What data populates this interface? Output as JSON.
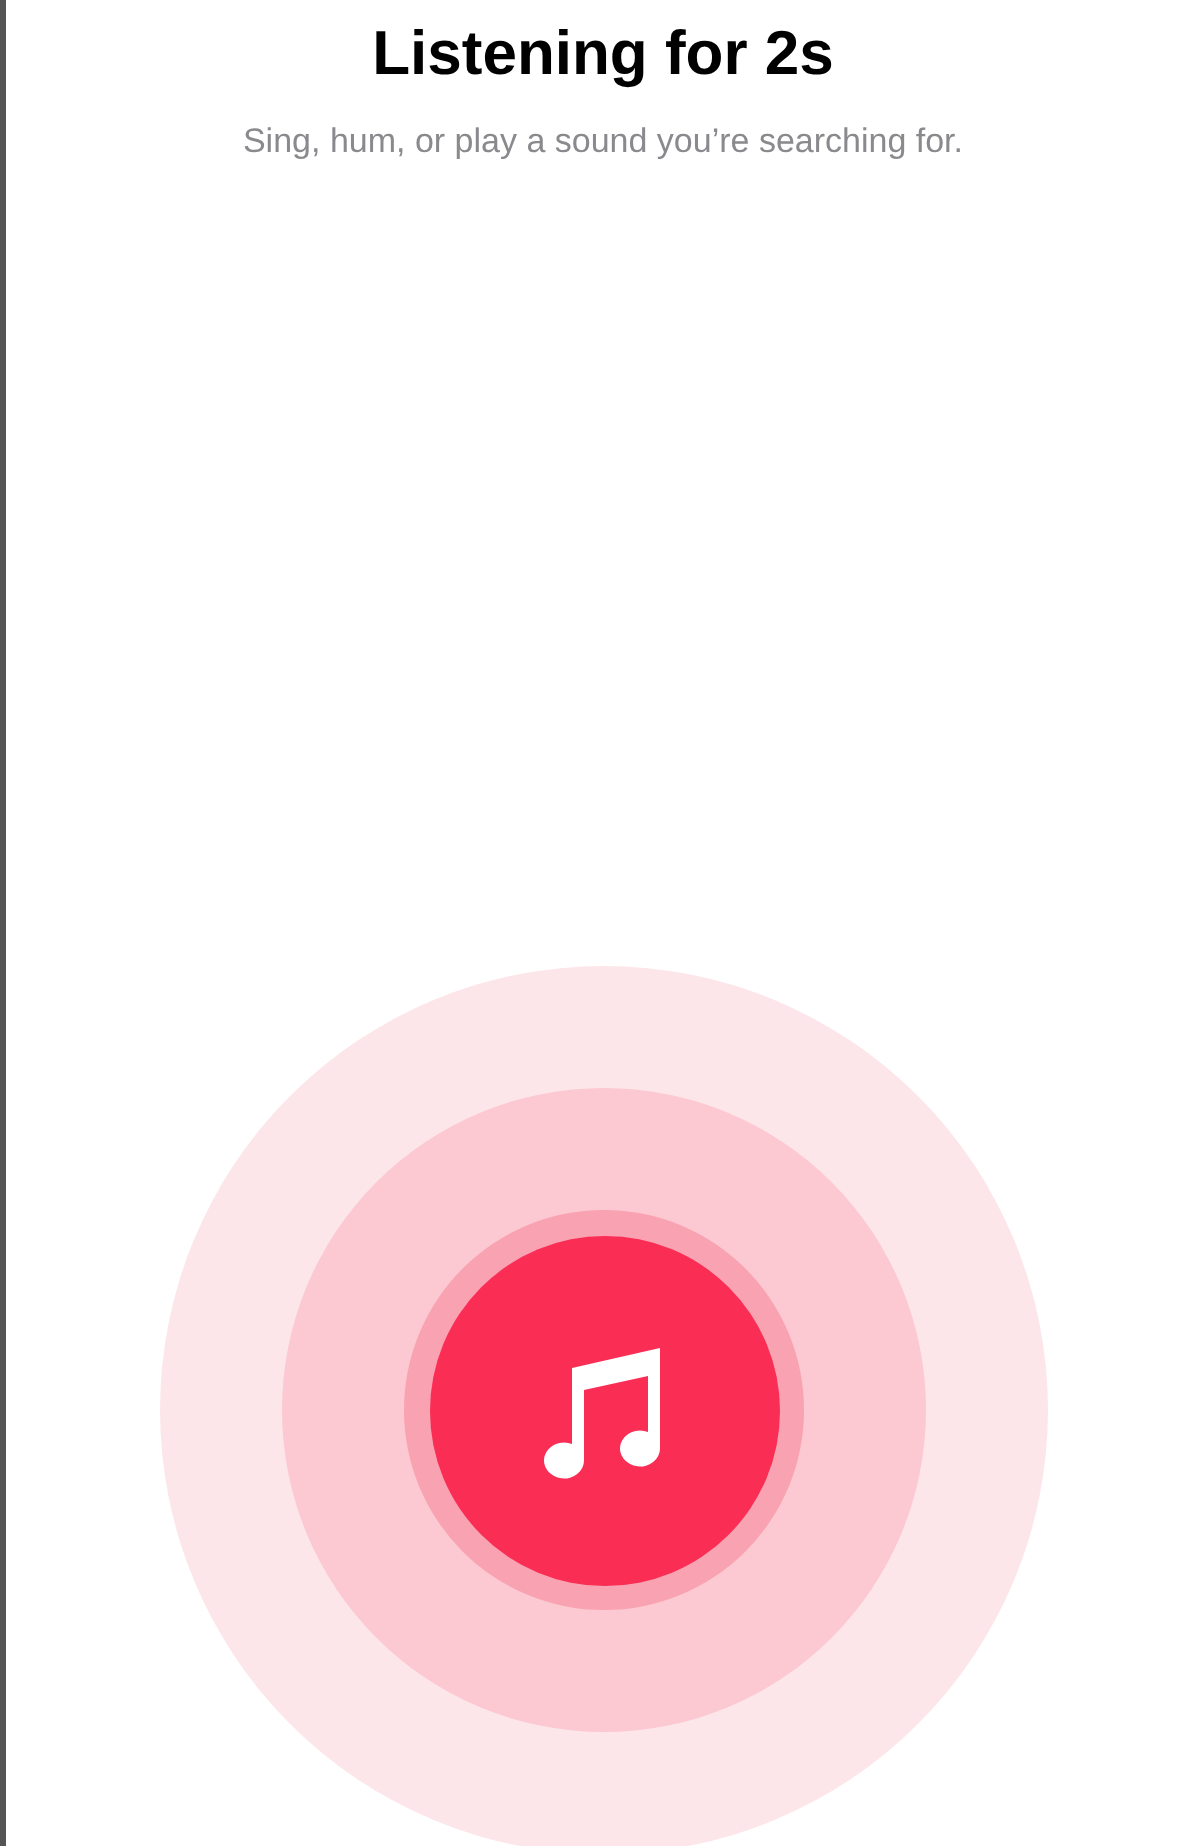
{
  "title": "Listening for 2s",
  "subtitle": "Sing, hum, or play a sound you’re searching for."
}
